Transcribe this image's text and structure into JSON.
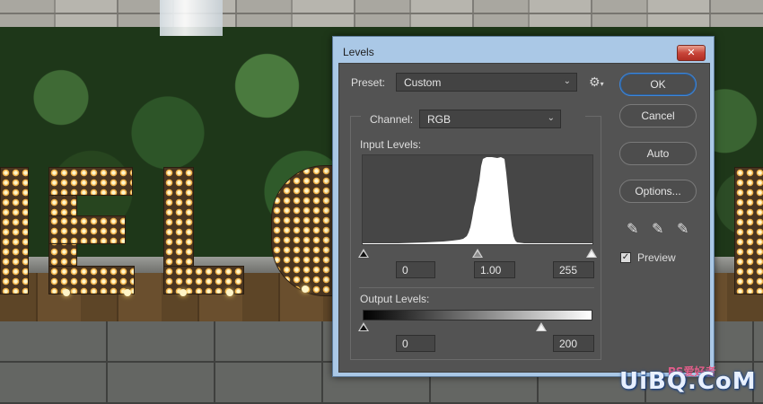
{
  "dialog": {
    "title": "Levels",
    "close_glyph": "✕",
    "preset": {
      "label": "Preset:",
      "value": "Custom"
    },
    "channel": {
      "label": "Channel:",
      "value": "RGB"
    },
    "input_levels": {
      "label": "Input Levels:",
      "black": "0",
      "gamma": "1.00",
      "white": "255"
    },
    "output_levels": {
      "label": "Output Levels:",
      "black": "0",
      "white": "200"
    },
    "buttons": {
      "ok": "OK",
      "cancel": "Cancel",
      "auto": "Auto",
      "options": "Options..."
    },
    "preview": {
      "label": "Preview",
      "checked": true
    },
    "eyedroppers": [
      "black-point-eyedropper-icon",
      "gray-point-eyedropper-icon",
      "white-point-eyedropper-icon"
    ]
  },
  "watermark": {
    "text": "UiBQ.CoM",
    "small": "PS爱好者"
  },
  "colors": {
    "accent": "#3f86d8",
    "panel": "#535353",
    "titlebar": "#aac8e6",
    "close": "#c8453a"
  }
}
